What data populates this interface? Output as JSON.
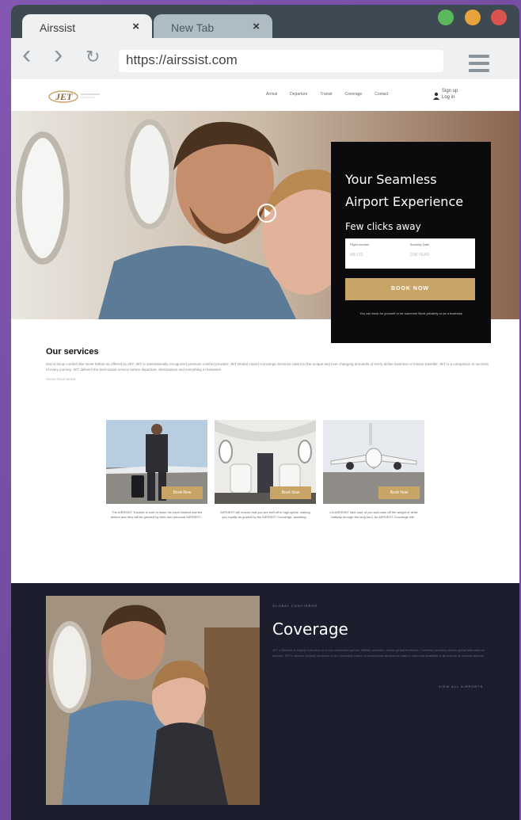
{
  "browser": {
    "tabs": [
      {
        "label": "Airssist",
        "close": "×"
      },
      {
        "label": "New Tab",
        "close": "×"
      }
    ],
    "url": "https://airssist.com",
    "controls": {
      "back": "‹",
      "forward": "›",
      "reload": "↻"
    },
    "traffic_lights": {
      "green": "#5cb85c",
      "yellow": "#e8a33b",
      "red": "#d9534f"
    }
  },
  "site": {
    "logo": "JET",
    "nav": [
      "Arrival",
      "Departure",
      "Transit",
      "Coverage",
      "Contact"
    ],
    "auth": {
      "signup": "Sign up",
      "login": "Log in"
    }
  },
  "hero": {
    "title_line1": "Your Seamless",
    "title_line2": "Airport Experience",
    "subtitle": "Few clicks away",
    "fields": [
      {
        "label": "Flight number",
        "value": "AB 123"
      },
      {
        "label": "Booking Date",
        "value": "D/M YEAR"
      }
    ],
    "cta": "BOOK NOW",
    "note": "You can book for yourself or for someone Book privately or as a business"
  },
  "services": {
    "heading": "Our services",
    "body": "Get to know comfort like never before as offered by JET. JET is internationally recognized premium comfort provider. JET Global Airport Concierge Services caters to the unique and ever changing demands of every airline business or leisure traveller. JET is a companion to success of every journey. JET delivers the best transit service before departure, destinations and everything in between!",
    "more": "SHOW READ MORE",
    "cards": [
      {
        "button": "Book Now",
        "text": "The AIRSSIST Traveler is sure to leave his travel related worries behind and they will be greeted by their own personal AIRSSIST..."
      },
      {
        "button": "Book Now",
        "text": "AIRSSIST will ensure that you are well off in high spirits, making you royalty as guided by the AIRSSIST Concierge, assisting..."
      },
      {
        "button": "Book Now",
        "text": "Let AIRSSIST take care of you and ease off the weight of while halfway through the long haul. An AIRSSIST Concierge will..."
      }
    ]
  },
  "coverage": {
    "kicker": "GLOBAL CONCIERGE",
    "title": "Coverage",
    "body": "JET's Network is largely extensive as it has conformed partner affiliate networks, across global territories. Currently available across global international airports. JET's network actively conforms to its expanding chains of exceptional services to make it regionally available in its entirety at network airports.",
    "link": "VIEW ALL AIRPORTS"
  },
  "colors": {
    "accent": "#c9a467",
    "dark": "#1c1e2e",
    "overlay": "#0b0b0d"
  }
}
